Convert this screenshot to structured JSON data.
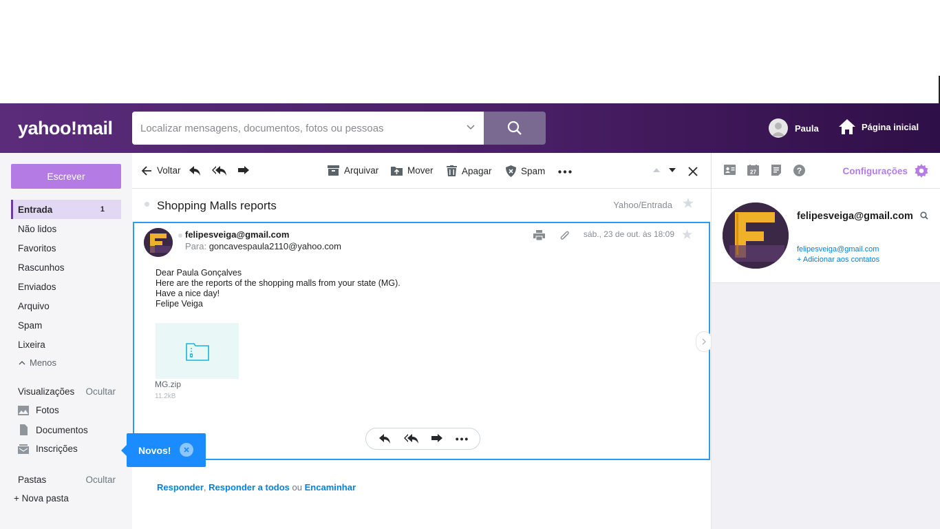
{
  "header": {
    "logo": "yahoo!mail",
    "search_placeholder": "Localizar mensagens, documentos, fotos ou pessoas",
    "user_name": "Paula",
    "home_label": "Página inicial"
  },
  "sidebar": {
    "compose_label": "Escrever",
    "folders": [
      {
        "label": "Entrada",
        "count": "1"
      },
      {
        "label": "Não lidos"
      },
      {
        "label": "Favoritos"
      },
      {
        "label": "Rascunhos"
      },
      {
        "label": "Enviados"
      },
      {
        "label": "Arquivo"
      },
      {
        "label": "Spam"
      },
      {
        "label": "Lixeira"
      }
    ],
    "less_label": "Menos",
    "views_title": "Visualizações",
    "views_hide": "Ocultar",
    "views": [
      "Fotos",
      "Documentos",
      "Inscrições"
    ],
    "folders_title": "Pastas",
    "folders_hide": "Ocultar",
    "new_folder": "+ Nova pasta"
  },
  "toolbar": {
    "back": "Voltar",
    "archive": "Arquivar",
    "move": "Mover",
    "delete": "Apagar",
    "spam": "Spam"
  },
  "message": {
    "subject": "Shopping Malls reports",
    "folder_path": "Yahoo/Entrada",
    "sender": "felipesveiga@gmail.com",
    "to_label": "Para:",
    "to": "goncavespaula2110@yahoo.com",
    "date": "sáb., 23 de out. às 18:09",
    "body": [
      "Dear Paula Gonçalves",
      "Here are the reports of the shopping malls from your state (MG).",
      "Have a nice day!",
      "Felipe Veiga"
    ],
    "attachment_name": "MG.zip",
    "attachment_size": "11.2kB"
  },
  "reply_links": {
    "reply": "Responder",
    "sep1": ",",
    "reply_all": "Responder a todos",
    "or": "ou",
    "forward": "Encaminhar"
  },
  "right_panel": {
    "settings": "Configurações",
    "calendar_day": "27",
    "contact_name": "felipesveiga@gmail.com",
    "contact_email": "felipesveiga@gmail.com",
    "add_contact": "+ Adicionar aos contatos"
  },
  "toast": {
    "label": "Novos!"
  },
  "colors": {
    "header_start": "#5a2c7a",
    "header_end": "#2f0f47",
    "accent": "#b57be5",
    "link": "#0081e0",
    "toast": "#1a8cff"
  }
}
